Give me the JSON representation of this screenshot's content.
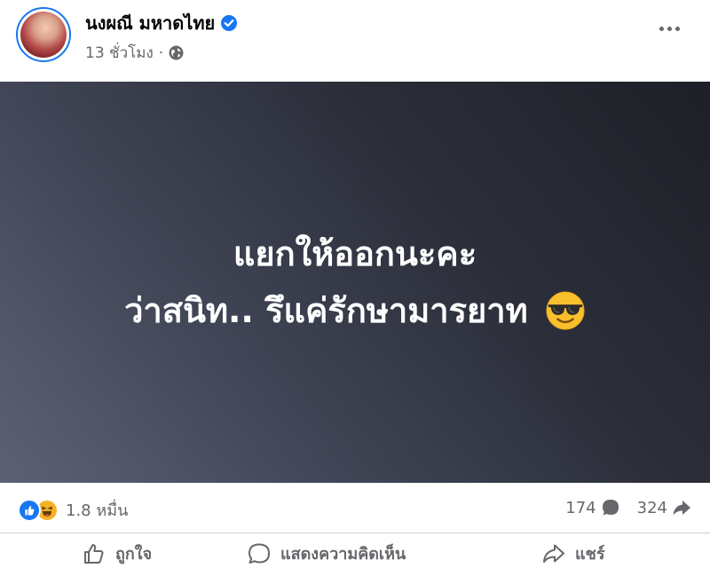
{
  "post": {
    "author": "นงผณี มหาดไทย",
    "time": "13 ชั่วโมง",
    "separator": "·",
    "line1": "แยกให้ออกนะคะ",
    "line2": "ว่าสนิท.. รึแค่รักษามารยาท",
    "emoji_icon": "smiling-face-with-sunglasses"
  },
  "stats": {
    "reactions": "1.8 หมื่น",
    "comments": "174",
    "shares": "324"
  },
  "actions": {
    "like": "ถูกใจ",
    "comment": "แสดงความคิดเห็น",
    "share": "แชร์"
  },
  "colors": {
    "accent": "#1877f2",
    "muted": "#65676b",
    "post_bg_light": "#5c6175",
    "post_bg_dark": "#1e2027"
  }
}
